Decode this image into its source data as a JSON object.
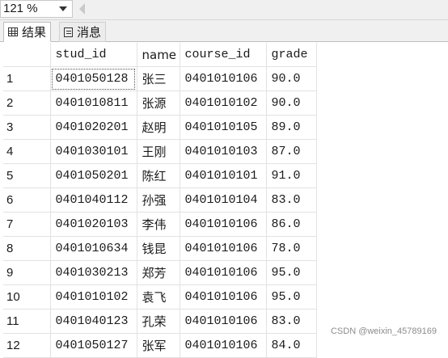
{
  "toolbar": {
    "zoom": "121 %"
  },
  "tabs": [
    {
      "label": "结果",
      "icon": "grid-icon",
      "active": true
    },
    {
      "label": "消息",
      "icon": "message-icon",
      "active": false
    }
  ],
  "grid": {
    "columns": [
      "stud_id",
      "name",
      "course_id",
      "grade"
    ],
    "rows": [
      {
        "num": "1",
        "stud_id": "0401050128",
        "name": "张三",
        "course_id": "0401010106",
        "grade": "90.0"
      },
      {
        "num": "2",
        "stud_id": "0401010811",
        "name": "张源",
        "course_id": "0401010102",
        "grade": "90.0"
      },
      {
        "num": "3",
        "stud_id": "0401020201",
        "name": "赵明",
        "course_id": "0401010105",
        "grade": "89.0"
      },
      {
        "num": "4",
        "stud_id": "0401030101",
        "name": "王刚",
        "course_id": "0401010103",
        "grade": "87.0"
      },
      {
        "num": "5",
        "stud_id": "0401050201",
        "name": "陈红",
        "course_id": "0401010101",
        "grade": "91.0"
      },
      {
        "num": "6",
        "stud_id": "0401040112",
        "name": "孙强",
        "course_id": "0401010104",
        "grade": "83.0"
      },
      {
        "num": "7",
        "stud_id": "0401020103",
        "name": "李伟",
        "course_id": "0401010106",
        "grade": "86.0"
      },
      {
        "num": "8",
        "stud_id": "0401010634",
        "name": "钱昆",
        "course_id": "0401010106",
        "grade": "78.0"
      },
      {
        "num": "9",
        "stud_id": "0401030213",
        "name": "郑芳",
        "course_id": "0401010106",
        "grade": "95.0"
      },
      {
        "num": "10",
        "stud_id": "0401010102",
        "name": "袁飞",
        "course_id": "0401010106",
        "grade": "95.0"
      },
      {
        "num": "11",
        "stud_id": "0401040123",
        "name": "孔荣",
        "course_id": "0401010106",
        "grade": "83.0"
      },
      {
        "num": "12",
        "stud_id": "0401050127",
        "name": "张军",
        "course_id": "0401010106",
        "grade": "84.0"
      }
    ]
  },
  "watermark": "CSDN @weixin_45789169"
}
